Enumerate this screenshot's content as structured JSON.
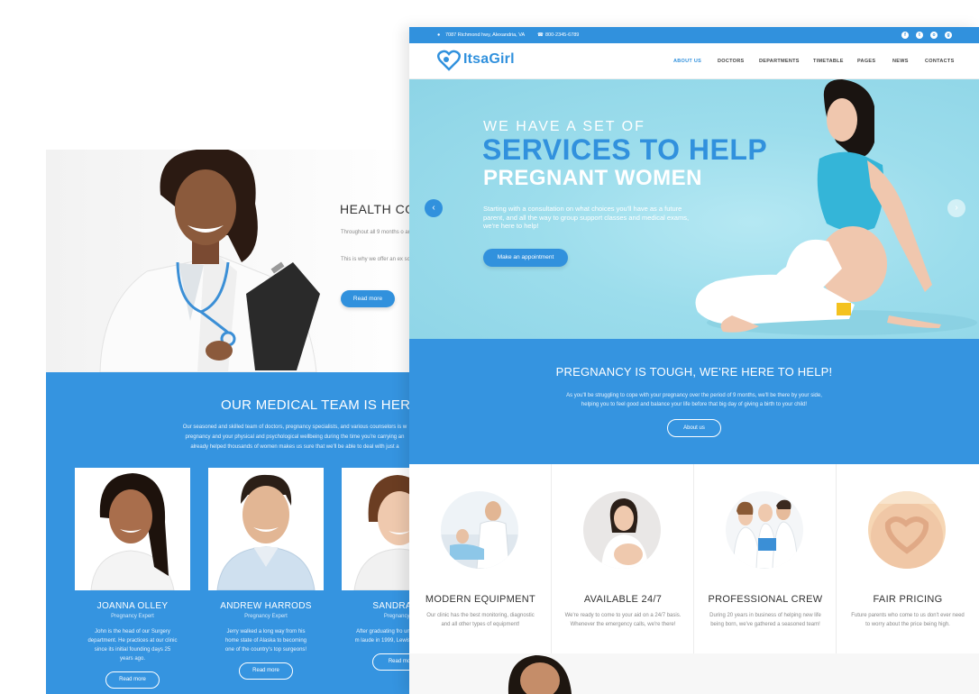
{
  "back_page": {
    "health_title": "HEALTH CO",
    "health_text_1": "Throughout all 9 months o ant than the state of your",
    "health_text_2": "This is why we offer an ex screenings and schedule",
    "read_more": "Read more",
    "team_title": "OUR MEDICAL TEAM IS HERE TO",
    "team_text": [
      "Our seasoned and skilled team of doctors, pregnancy specialists, and various counselors is w",
      "pregnancy and your physical and psychological wellbeing during the time you're carrying an",
      "already helped thousands of women makes us sure that we'll be able to deal with just a"
    ],
    "members": [
      {
        "name": "JOANNA OLLEY",
        "role": "Pregnancy Expert",
        "desc": "John is the head of our Surgery department. He practices at our clinic since its initial founding days 25 years ago.",
        "button": "Read more"
      },
      {
        "name": "ANDREW HARRODS",
        "role": "Pregnancy Expert",
        "desc": "Jerry walked a long way from his home state of Alaska to becoming one of the country's top surgeons!",
        "button": "Read more"
      },
      {
        "name": "SANDRA VA",
        "role": "Pregnancy E",
        "desc": "After graduating fro university with a m laude in 1999, Lewis our medical c",
        "button": "Read mo"
      }
    ]
  },
  "front_page": {
    "topbar": {
      "address": "7087 Richmond hwy, Alexandria, VA",
      "phone": "800-2345-6789",
      "social_icons": [
        "facebook-icon",
        "twitter-icon",
        "instagram-icon",
        "google-plus-icon"
      ]
    },
    "logo": "ItsaGirl",
    "nav": [
      "ABOUT US",
      "DOCTORS",
      "DEPARTMENTS",
      "TIMETABLE",
      "PAGES",
      "NEWS",
      "CONTACTS"
    ],
    "hero": {
      "line1": "WE HAVE A SET OF",
      "line2": "SERVICES TO HELP",
      "line3": "PREGNANT WOMEN",
      "text": "Starting with a consultation on what choices you'll have as a future parent, and all the way to group support classes and medical exams, we're here to help!",
      "button": "Make an appointment",
      "prev": "‹",
      "next": "›"
    },
    "tough": {
      "title": "PREGNANCY IS TOUGH, WE'RE HERE TO HELP!",
      "text_1": "As you'll be struggling to cope with your pregnancy over the period of 9 months, we'll be there by your side,",
      "text_2": "helping you to feel good and balance your life before that big day of giving a birth to your child!",
      "button": "About us"
    },
    "features": [
      {
        "title": "MODERN EQUIPMENT",
        "text": "Our clinic has the best monitoring, diagnostic and all other types of equipment!"
      },
      {
        "title": "AVAILABLE 24/7",
        "text": "We're ready to come to your aid on a 24/7 basis. Whenever the emergency calls, we're there!"
      },
      {
        "title": "PROFESSIONAL CREW",
        "text": "During 20 years in business of helping new life being born, we've gathered a seasoned team!"
      },
      {
        "title": "FAIR PRICING",
        "text": "Future parents who come to us don't ever need to worry about the price being high."
      }
    ]
  },
  "colors": {
    "brand_blue": "#3191dd",
    "section_blue": "#3594e0",
    "hero_cyan": "#9cddec"
  }
}
